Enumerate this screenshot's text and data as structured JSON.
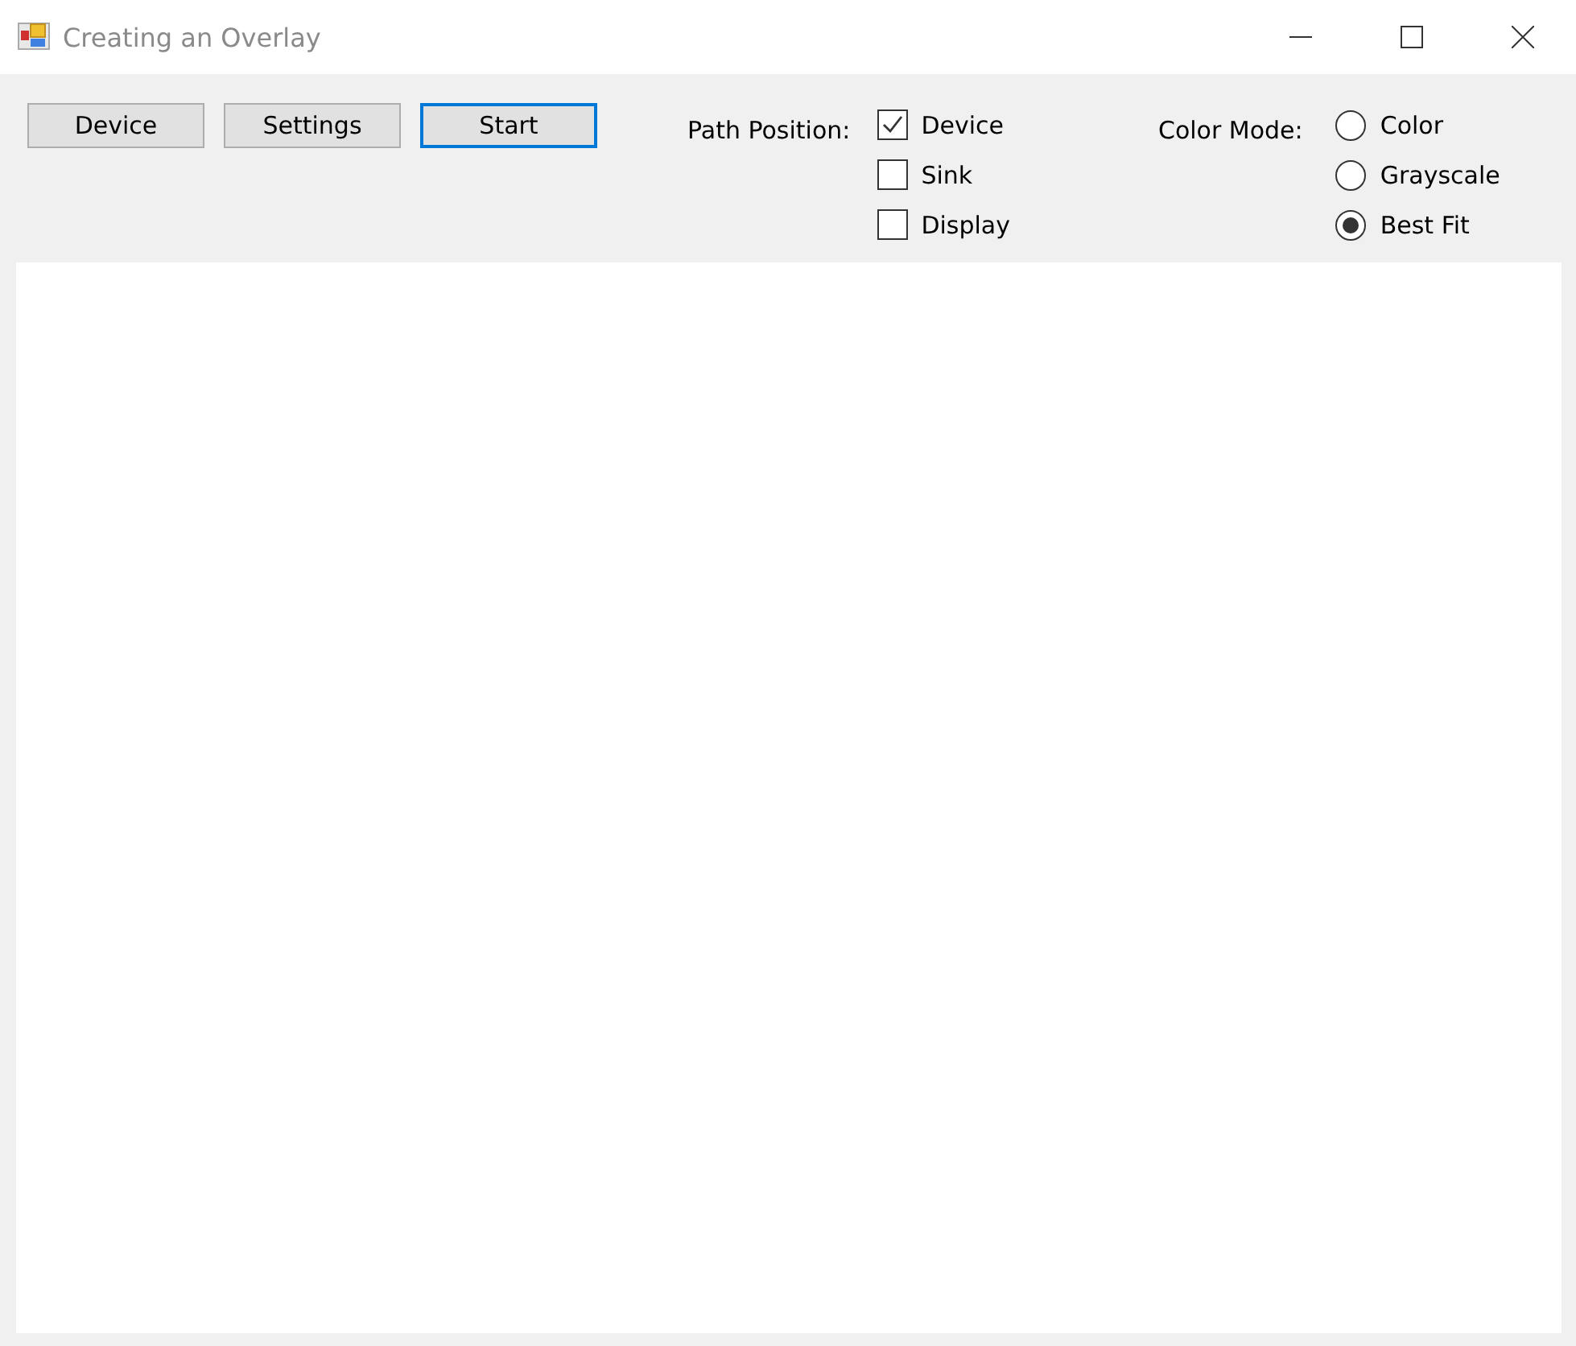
{
  "window": {
    "title": "Creating an Overlay"
  },
  "buttons": [
    {
      "label": "Device",
      "focused": false
    },
    {
      "label": "Settings",
      "focused": false
    },
    {
      "label": "Start",
      "focused": true
    }
  ],
  "path_position": {
    "label": "Path Position:",
    "options": [
      {
        "label": "Device",
        "checked": true
      },
      {
        "label": "Sink",
        "checked": false
      },
      {
        "label": "Display",
        "checked": false
      }
    ]
  },
  "color_mode": {
    "label": "Color Mode:",
    "options": [
      {
        "label": "Color",
        "selected": false
      },
      {
        "label": "Grayscale",
        "selected": false
      },
      {
        "label": "Best Fit",
        "selected": true
      }
    ]
  }
}
